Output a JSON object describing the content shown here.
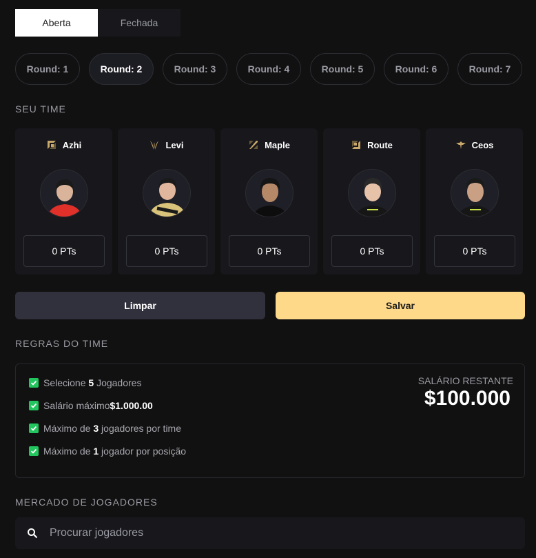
{
  "tabs": [
    {
      "label": "Aberta",
      "active": true
    },
    {
      "label": "Fechada",
      "active": false
    }
  ],
  "rounds": [
    {
      "label": "Round: 1"
    },
    {
      "label": "Round: 2",
      "active": true
    },
    {
      "label": "Round: 3"
    },
    {
      "label": "Round: 4"
    },
    {
      "label": "Round: 5"
    },
    {
      "label": "Round: 6"
    },
    {
      "label": "Round: 7"
    }
  ],
  "team_section": {
    "title": "SEU TIME"
  },
  "players": [
    {
      "name": "Azhi",
      "role_icon": "top-lane-icon",
      "points": "0 PTs",
      "jersey": "#e0302a"
    },
    {
      "name": "Levi",
      "role_icon": "jungle-icon",
      "points": "0 PTs",
      "jersey": "#d9c27a"
    },
    {
      "name": "Maple",
      "role_icon": "mid-lane-icon",
      "points": "0 PTs",
      "jersey": "#1a1a1a"
    },
    {
      "name": "Route",
      "role_icon": "bot-lane-icon",
      "points": "0 PTs",
      "jersey": "#1a1a1a"
    },
    {
      "name": "Ceos",
      "role_icon": "support-icon",
      "points": "0 PTs",
      "jersey": "#1a1a1a"
    }
  ],
  "actions": {
    "clear_label": "Limpar",
    "save_label": "Salvar"
  },
  "rules_section": {
    "title": "REGRAS DO TIME",
    "rules": [
      {
        "pre": "Selecione ",
        "bold": "5",
        "post": " Jogadores"
      },
      {
        "pre": "Salário máximo",
        "bold": "$1.000.00",
        "post": ""
      },
      {
        "pre": "Máximo de ",
        "bold": "3",
        "post": " jogadores por time"
      },
      {
        "pre": "Máximo de ",
        "bold": "1",
        "post": " jogador por posição"
      }
    ],
    "salary_label": "SALÁRIO RESTANTE",
    "salary_value": "$100.000"
  },
  "market_section": {
    "title": "MERCADO DE JOGADORES",
    "search_placeholder": "Procurar jogadores"
  },
  "colors": {
    "accent": "#ffd98a",
    "check": "#22c55e",
    "background": "#111111",
    "card": "#17171c"
  }
}
